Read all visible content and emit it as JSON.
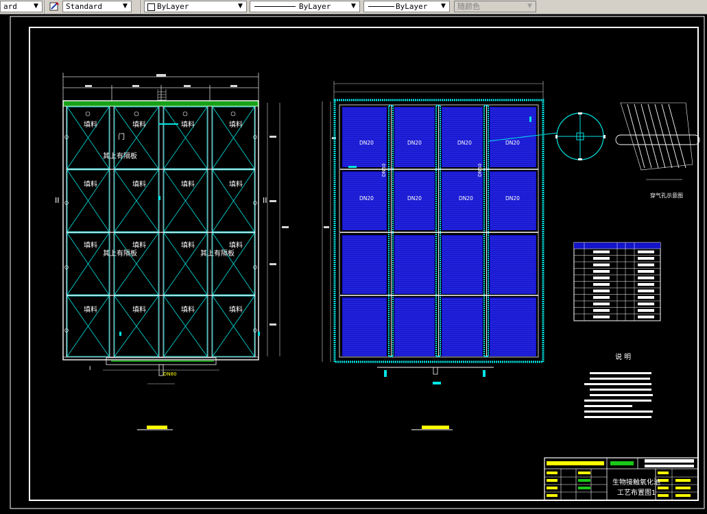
{
  "toolbar": {
    "text_style": "ard",
    "dim_style": "Standard",
    "layer_color": "ByLayer",
    "linetype": "ByLayer",
    "lineweight": "ByLayer",
    "plot_color": "随颜色"
  },
  "drawing": {
    "left_panel": {
      "fill_label": "填料",
      "plate_label": "其上有隔板",
      "door_label": "门",
      "section_left": "I",
      "section_right": "II",
      "pipe_label": "DN80"
    },
    "center_panel": {
      "pipe_label": "DN20",
      "main_pipe": "DN50"
    },
    "right_panel": {
      "detail_caption": "穿气孔示意图",
      "notes_title": "说 明",
      "title_main": "生物接触氧化池",
      "title_sub": "工艺布置图1"
    },
    "colors": {
      "frame": "#ffffff",
      "outline": "#ffffff",
      "cyan": "#00e5e5",
      "blue": "#1414c8",
      "green": "#19c819",
      "yellow": "#ffff00",
      "dim": "#d8d8d8"
    }
  }
}
